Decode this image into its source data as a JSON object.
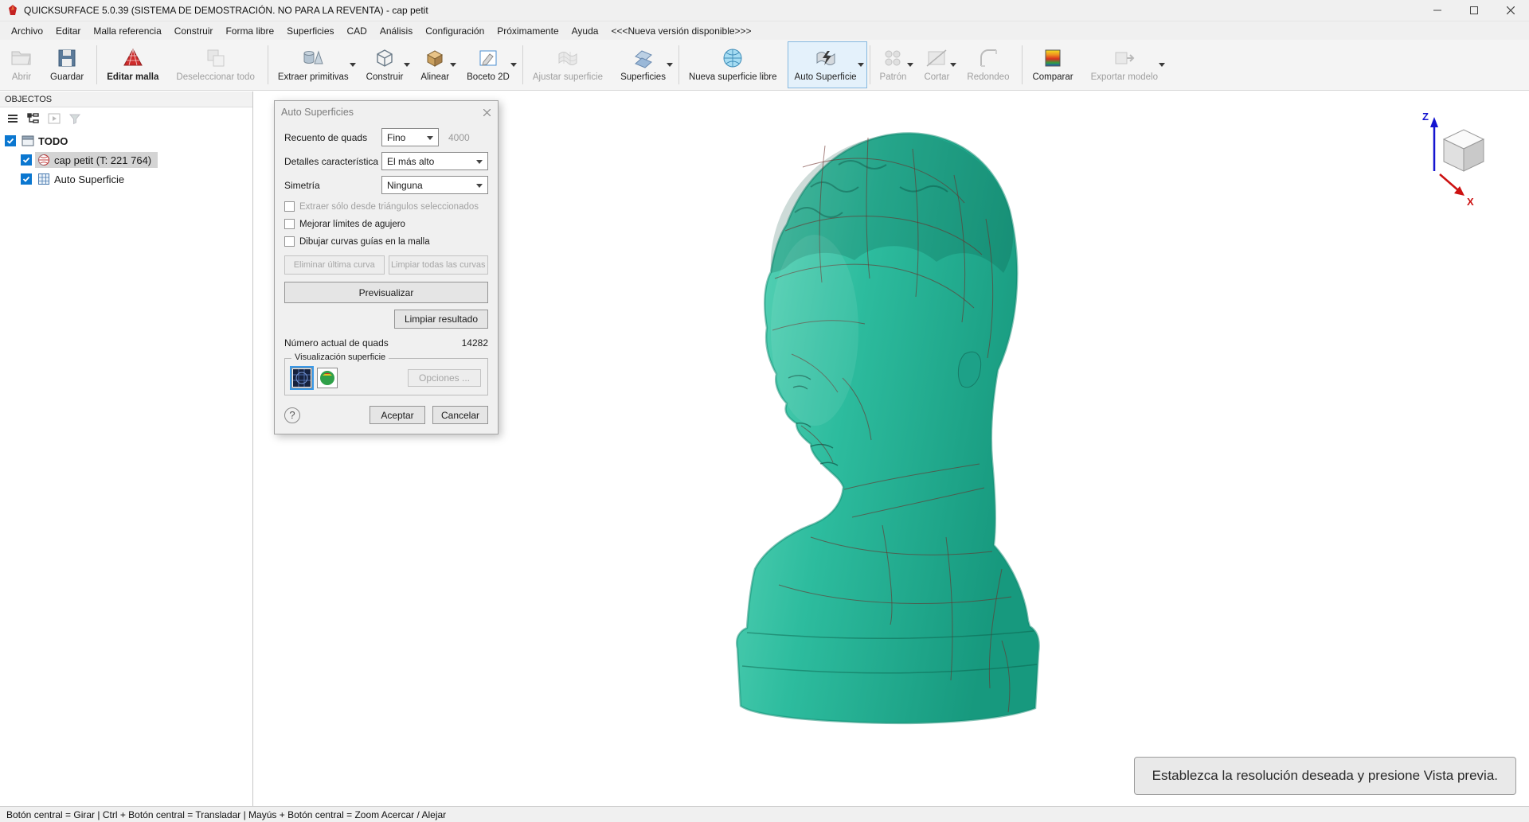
{
  "window": {
    "title": "QUICKSURFACE 5.0.39 (SISTEMA DE DEMOSTRACIÓN. NO PARA LA REVENTA) - cap petit"
  },
  "menubar": {
    "items": [
      "Archivo",
      "Editar",
      "Malla referencia",
      "Construir",
      "Forma libre",
      "Superficies",
      "CAD",
      "Análisis",
      "Configuración",
      "Próximamente",
      "Ayuda",
      "<<<Nueva versión disponible>>>"
    ]
  },
  "toolbar": {
    "buttons": [
      {
        "label": "Abrir"
      },
      {
        "label": "Guardar"
      },
      {
        "label": "Editar malla"
      },
      {
        "label": "Deseleccionar todo"
      },
      {
        "label": "Extraer primitivas"
      },
      {
        "label": "Construir"
      },
      {
        "label": "Alinear"
      },
      {
        "label": "Boceto 2D"
      },
      {
        "label": "Ajustar superficie"
      },
      {
        "label": "Superficies"
      },
      {
        "label": "Nueva superficie libre"
      },
      {
        "label": "Auto Superficie"
      },
      {
        "label": "Patrón"
      },
      {
        "label": "Cortar"
      },
      {
        "label": "Redondeo"
      },
      {
        "label": "Comparar"
      },
      {
        "label": "Exportar modelo"
      }
    ]
  },
  "objects": {
    "header": "OBJECTOS",
    "tree": {
      "root": "TODO",
      "items": [
        {
          "label": "cap petit (T: 221 764)"
        },
        {
          "label": "Auto Superficie"
        }
      ]
    }
  },
  "dialog": {
    "title": "Auto Superficies",
    "rows": [
      {
        "label": "Recuento de quads",
        "value": "Fino",
        "aux": "4000"
      },
      {
        "label": "Detalles característica",
        "value": "El más alto"
      },
      {
        "label": "Simetría",
        "value": "Ninguna"
      }
    ],
    "checkboxes": [
      {
        "label": "Extraer sólo desde triángulos seleccionados"
      },
      {
        "label": "Mejorar límites de agujero"
      },
      {
        "label": "Dibujar curvas guías en la malla"
      }
    ],
    "buttons": {
      "delete_last_curve": "Eliminar última curva",
      "clear_all_curves": "Limpiar todas las curvas",
      "preview": "Previsualizar",
      "clear_result": "Limpiar resultado",
      "options": "Opciones ...",
      "accept": "Aceptar",
      "cancel": "Cancelar"
    },
    "quads_label": "Número actual de quads",
    "quads_value": "14282",
    "viz_group_label": "Visualización superficie",
    "help_label": "?"
  },
  "viewport": {
    "hint": "Establezca la resolución deseada y presione Vista previa.",
    "axis": {
      "x": "X",
      "z": "Z"
    }
  },
  "statusbar": {
    "text": "Botón central = Girar | Ctrl + Botón central = Transladar | Mayús + Botón central = Zoom Acercar / Alejar"
  },
  "colors": {
    "bust_light": "#6adbc0",
    "bust_mid": "#2dbc9e",
    "bust_dark": "#17997e",
    "accent": "#0b77d0",
    "wireframe": "#6b2f2a"
  }
}
